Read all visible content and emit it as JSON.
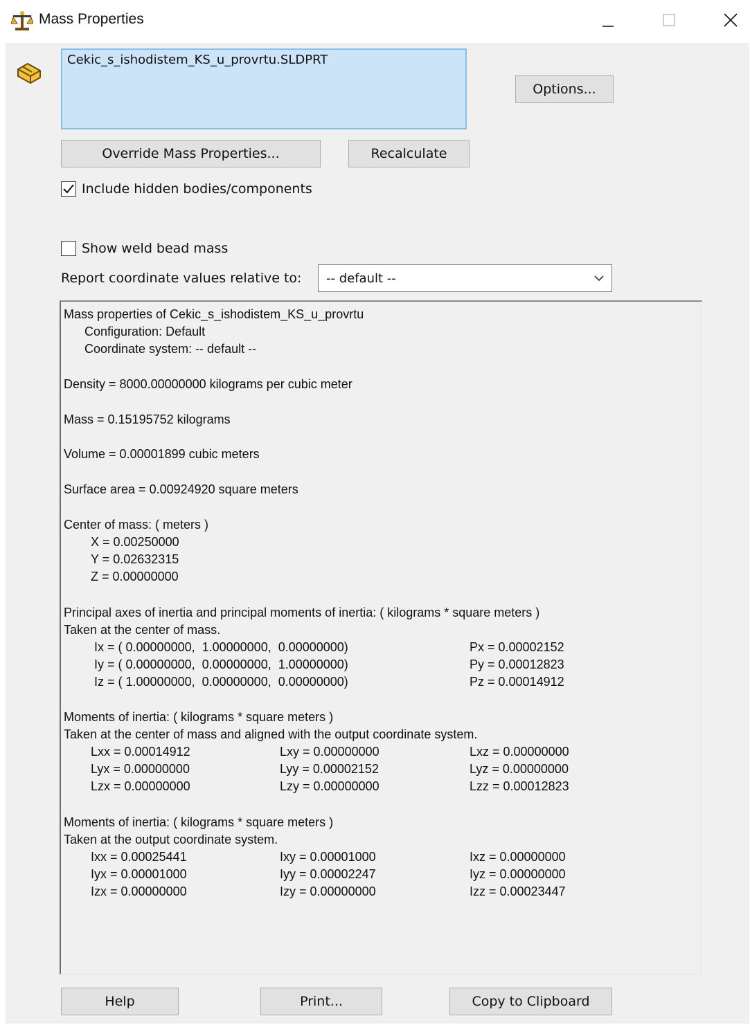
{
  "window": {
    "title": "Mass Properties",
    "minimize_icon": "minimize-icon",
    "maximize_icon": "maximize-icon",
    "close_icon": "close-icon"
  },
  "selection": {
    "items": [
      "Cekic_s_ishodistem_KS_u_provrtu.SLDPRT"
    ]
  },
  "buttons": {
    "options": "Options...",
    "override": "Override Mass Properties...",
    "recalculate": "Recalculate",
    "help": "Help",
    "print": "Print...",
    "copy": "Copy to Clipboard"
  },
  "options": {
    "include_hidden_label": "Include hidden bodies/components",
    "include_hidden_checked": true,
    "weld_bead_label": "Show weld bead mass",
    "weld_bead_checked": false,
    "coord_label": "Report coordinate values relative to:",
    "coord_value": "-- default --"
  },
  "report": {
    "header": "Mass properties of Cekic_s_ishodistem_KS_u_provrtu",
    "configuration": "Configuration: Default",
    "coordinate_system": "Coordinate system: -- default --",
    "density": "Density = 8000.00000000 kilograms per cubic meter",
    "mass": "Mass = 0.15195752 kilograms",
    "volume": "Volume = 0.00001899 cubic meters",
    "surface_area": "Surface area = 0.00924920 square meters",
    "com_header": "Center of mass: ( meters )",
    "com_x": "X = 0.00250000",
    "com_y": "Y = 0.02632315",
    "com_z": "Z = 0.00000000",
    "principal_header": "Principal axes of inertia and principal moments of inertia: ( kilograms * square meters )",
    "principal_sub": "Taken at the center of mass.",
    "principal_rows": [
      {
        "axis": "Ix = ( 0.00000000,  1.00000000,  0.00000000)",
        "moment": "Px = 0.00002152"
      },
      {
        "axis": "Iy = ( 0.00000000,  0.00000000,  1.00000000)",
        "moment": "Py = 0.00012823"
      },
      {
        "axis": "Iz = ( 1.00000000,  0.00000000,  0.00000000)",
        "moment": "Pz = 0.00014912"
      }
    ],
    "moi_com_header": "Moments of inertia: ( kilograms * square meters )",
    "moi_com_sub": "Taken at the center of mass and aligned with the output coordinate system.",
    "moi_com_rows": [
      [
        "Lxx = 0.00014912",
        "Lxy = 0.00000000",
        "Lxz = 0.00000000"
      ],
      [
        "Lyx = 0.00000000",
        "Lyy = 0.00002152",
        "Lyz = 0.00000000"
      ],
      [
        "Lzx = 0.00000000",
        "Lzy = 0.00000000",
        "Lzz = 0.00012823"
      ]
    ],
    "moi_out_header": "Moments of inertia: ( kilograms * square meters )",
    "moi_out_sub": "Taken at the output coordinate system.",
    "moi_out_rows": [
      [
        "Ixx = 0.00025441",
        "Ixy = 0.00001000",
        "Ixz = 0.00000000"
      ],
      [
        "Iyx = 0.00001000",
        "Iyy = 0.00002247",
        "Iyz = 0.00000000"
      ],
      [
        "Izx = 0.00000000",
        "Izy = 0.00000000",
        "Izz = 0.00023447"
      ]
    ]
  },
  "colors": {
    "dialog_bg": "#f0f0f0",
    "selection_bg": "#cce4f7",
    "selection_border": "#8cbde6",
    "button_bg": "#e1e1e1",
    "icon_gold": "#e8b020"
  }
}
